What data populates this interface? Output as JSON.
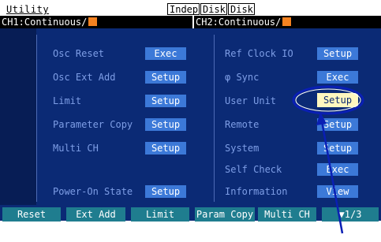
{
  "header": {
    "title": "Utility",
    "badges": [
      "Indep",
      "Disk",
      "Disk"
    ],
    "ch1": "CH1:Continuous/",
    "ch2": "CH2:Continuous/"
  },
  "left_column": [
    {
      "label": "Osc Reset",
      "button": "Exec"
    },
    {
      "label": "Osc Ext Add",
      "button": "Setup"
    },
    {
      "label": "Limit",
      "button": "Setup"
    },
    {
      "label": "Parameter Copy",
      "button": "Setup"
    },
    {
      "label": "Multi CH",
      "button": "Setup"
    },
    {
      "label": "Power-On State",
      "button": "Setup"
    }
  ],
  "right_column": [
    {
      "label": "Ref Clock IO",
      "button": "Setup"
    },
    {
      "label": "φ Sync",
      "button": "Exec"
    },
    {
      "label": "User Unit",
      "button": "Setup"
    },
    {
      "label": "Remote",
      "button": "Setup"
    },
    {
      "label": "System",
      "button": "Setup"
    },
    {
      "label": "Self Check",
      "button": "Exec"
    },
    {
      "label": "Information",
      "button": "View"
    }
  ],
  "function_keys": [
    "Reset",
    "Ext Add",
    "Limit",
    "Param Copy",
    "Multi CH",
    "▼1/3"
  ],
  "colors": {
    "panel_bg": "#0b2a75",
    "button": "#3c79d8",
    "label": "#7e9ee6",
    "highlight_button": "#fff7bf",
    "function_key": "#1f7d8f",
    "channel_indicator": "#f58220",
    "annotation": "#0a1fb4"
  }
}
